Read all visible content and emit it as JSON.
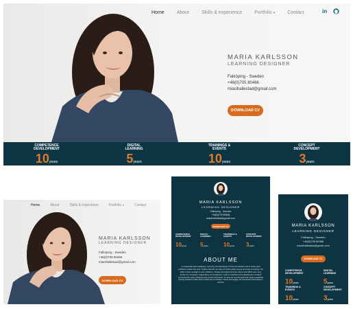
{
  "nav": {
    "items": [
      "Home",
      "About",
      "Skills & experience",
      "Portfolio",
      "Contact"
    ],
    "active": "Home",
    "portfolio_caret": "▾",
    "linkedin": "in",
    "github": "github-icon"
  },
  "profile": {
    "name": "MARIA KARLSSON",
    "role": "LEARNING DESIGNER",
    "location": "Falköping - Sweden",
    "phone": "+46(0)705 80466",
    "email": "miacihallestad@gmail.com"
  },
  "cta": {
    "download": "DOWNLOAD CV"
  },
  "stats": [
    {
      "label": "COMPETENCE DEVELOPMENT",
      "value": "10",
      "unit": "years"
    },
    {
      "label": "DIGITAL LEARNING",
      "value": "5",
      "unit": "years"
    },
    {
      "label": "TRAININGS & EVENTS",
      "value": "10",
      "unit": "years"
    },
    {
      "label": "CONCEPT DEVELOPMENT",
      "value": "3",
      "unit": "years"
    }
  ],
  "about": {
    "title": "ABOUT ME",
    "body": "I'm passionate about designing, improving, and developing. To find new solutions and to create good conditions to learn and grow. I believe that the new ways of working today require new ways of learning. Our ability to learn as adapt to new conditions, changed perceptions and new roles is and will be even more crucial. For companies, organizations and employees. I want to contribute to the development of today's and tomorrow's ways of learning and transfer information. To meet the new demands and create sustainable learning solutions in skill, both in public and in business. Inspire and engage. For successful performance in work life."
  },
  "colors": {
    "navy": "#0c3644",
    "accent": "#e4792a",
    "button": "#d86b1f"
  }
}
